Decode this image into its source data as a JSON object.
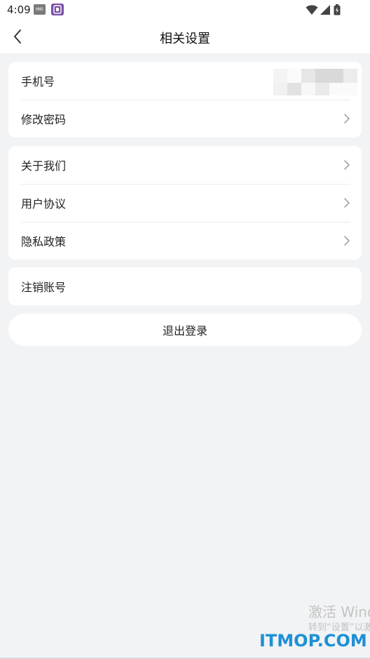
{
  "status_bar": {
    "time": "4:09",
    "notif1_label": "HHS"
  },
  "header": {
    "title": "相关设置"
  },
  "account_card": {
    "phone_label": "手机号",
    "change_password_label": "修改密码"
  },
  "info_card": {
    "about_label": "关于我们",
    "user_agreement_label": "用户协议",
    "privacy_policy_label": "隐私政策"
  },
  "cancel_card": {
    "cancel_account_label": "注销账号"
  },
  "logout": {
    "label": "退出登录"
  },
  "watermark": {
    "activate_line1": "激活 Windows",
    "activate_line2": "转到“设置”以激活 Windows。",
    "site": "ITMOP.COM"
  },
  "colors": {
    "background": "#f2f3f5",
    "card": "#ffffff",
    "watermark_blue": "#1e90d6"
  }
}
